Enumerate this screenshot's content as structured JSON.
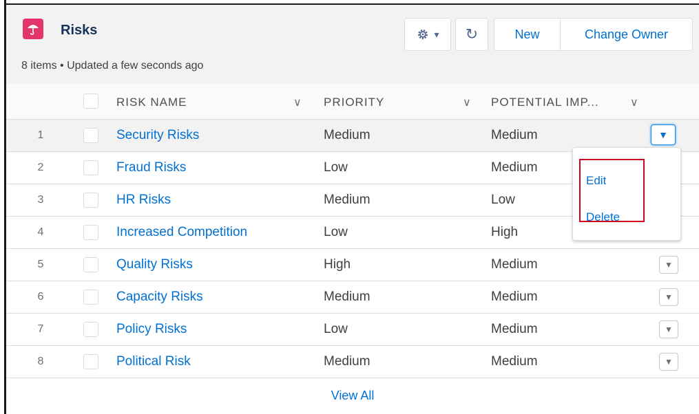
{
  "list": {
    "title": "Risks",
    "meta": "8 items • Updated a few seconds ago",
    "icon": "umbrella-icon",
    "icon_color": "#e3356b"
  },
  "toolbar": {
    "gear_icon": "gear-icon",
    "gear_caret": "▾",
    "refresh_glyph": "↻",
    "new_label": "New",
    "change_owner_label": "Change Owner"
  },
  "columns": {
    "risk_name": "RISK NAME",
    "priority": "PRIORITY",
    "potential_impact": "POTENTIAL IMP...",
    "caret": "∨"
  },
  "rows": [
    {
      "num": "1",
      "name": "Security Risks",
      "priority": "Medium",
      "impact": "Medium"
    },
    {
      "num": "2",
      "name": "Fraud Risks",
      "priority": "Low",
      "impact": "Medium"
    },
    {
      "num": "3",
      "name": "HR Risks",
      "priority": "Medium",
      "impact": "Low"
    },
    {
      "num": "4",
      "name": "Increased Competition",
      "priority": "Low",
      "impact": "High"
    },
    {
      "num": "5",
      "name": "Quality Risks",
      "priority": "High",
      "impact": "Medium"
    },
    {
      "num": "6",
      "name": "Capacity Risks",
      "priority": "Medium",
      "impact": "Medium"
    },
    {
      "num": "7",
      "name": "Policy Risks",
      "priority": "Low",
      "impact": "Medium"
    },
    {
      "num": "8",
      "name": "Political Risk",
      "priority": "Medium",
      "impact": "Medium"
    }
  ],
  "row_action_glyph": "▼",
  "menu": {
    "edit_label": "Edit",
    "delete_label": "Delete"
  },
  "footer": {
    "view_all_label": "View All"
  },
  "colors": {
    "link": "#0070d2",
    "highlight_box": "#d0021b",
    "header_bg": "#f3f2f2"
  }
}
